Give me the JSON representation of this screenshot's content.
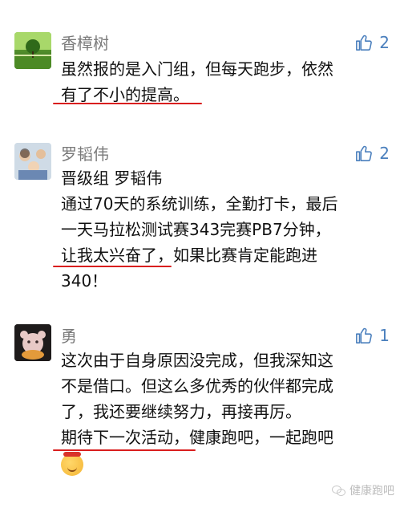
{
  "comments": [
    {
      "name": "香樟树",
      "likes": "2",
      "lines": [
        "虽然报的是入门组，但每天跑步，依然",
        "有了不小的提高。"
      ]
    },
    {
      "name": "罗韬伟",
      "likes": "2",
      "lines": [
        "晋级组 罗韬伟",
        "通过70天的系统训练，全勤打卡，最后",
        "一天马拉松测试赛343完赛PB7分钟，",
        "让我太兴奋了，如果比赛肯定能跑进",
        "340！"
      ]
    },
    {
      "name": "勇",
      "likes": "1",
      "lines": [
        "这次由于自身原因没完成，但我深知这",
        "不是借口。但这么多优秀的伙伴都完成",
        "了，我还要继续努力，再接再厉。",
        "期待下一次活动，健康跑吧，一起跑吧"
      ]
    }
  ],
  "watermark": "健康跑吧",
  "colors": {
    "underline": "#d91e1e",
    "like": "#4a7fbd",
    "name": "#7a7a7a"
  }
}
